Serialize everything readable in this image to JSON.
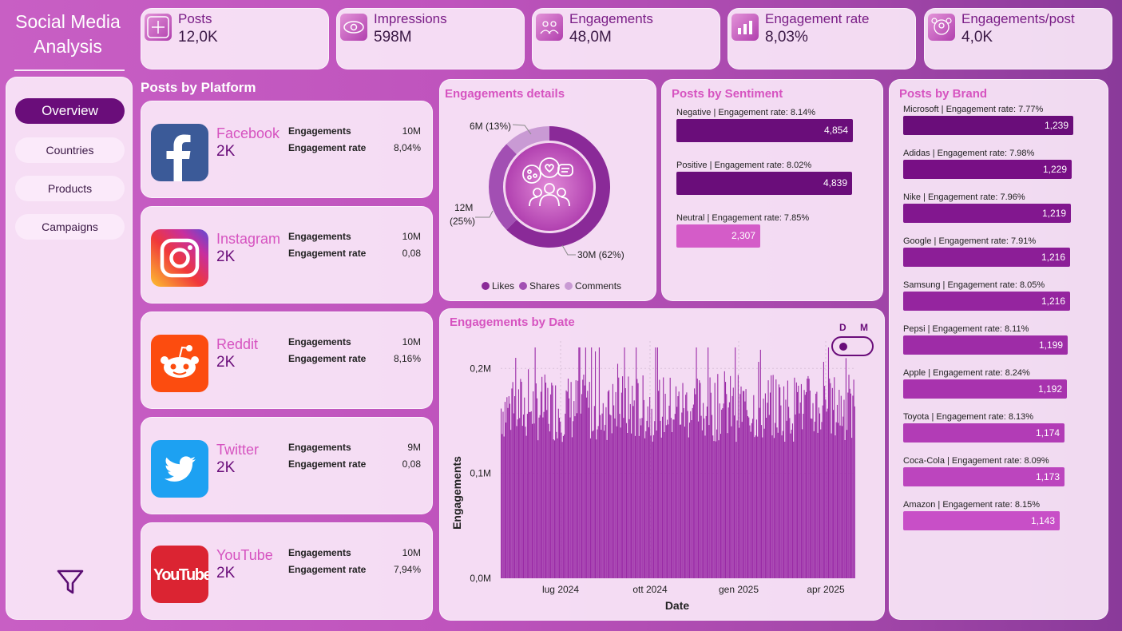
{
  "app": {
    "title_line1": "Social Media",
    "title_line2": "Analysis"
  },
  "nav": {
    "items": [
      {
        "label": "Overview",
        "active": true
      },
      {
        "label": "Countries",
        "active": false
      },
      {
        "label": "Products",
        "active": false
      },
      {
        "label": "Campaigns",
        "active": false
      }
    ]
  },
  "kpis": [
    {
      "label": "Posts",
      "value": "12,0K",
      "icon": "plus-icon"
    },
    {
      "label": "Impressions",
      "value": "598M",
      "icon": "eye-icon"
    },
    {
      "label": "Engagements",
      "value": "48,0M",
      "icon": "people-icon"
    },
    {
      "label": "Engagement rate",
      "value": "8,03%",
      "icon": "chart-icon"
    },
    {
      "label": "Engagements/post",
      "value": "4,0K",
      "icon": "users-icon"
    }
  ],
  "platforms": {
    "title": "Posts by Platform",
    "metric_labels": {
      "engagements": "Engagements",
      "rate": "Engagement rate"
    },
    "items": [
      {
        "name": "Facebook",
        "posts": "2K",
        "engagements": "10M",
        "rate": "8,04%",
        "icon": "facebook-icon"
      },
      {
        "name": "Instagram",
        "posts": "2K",
        "engagements": "10M",
        "rate": "0,08",
        "icon": "instagram-icon"
      },
      {
        "name": "Reddit",
        "posts": "2K",
        "engagements": "10M",
        "rate": "8,16%",
        "icon": "reddit-icon"
      },
      {
        "name": "Twitter",
        "posts": "2K",
        "engagements": "9M",
        "rate": "0,08",
        "icon": "twitter-icon"
      },
      {
        "name": "YouTube",
        "posts": "2K",
        "engagements": "10M",
        "rate": "7,94%",
        "icon": "youtube-icon"
      }
    ]
  },
  "engagement_details": {
    "title": "Engagements details",
    "slice_labels": [
      "30M (62%)",
      "12M",
      "(25%)",
      "6M (13%)"
    ],
    "legend": [
      "Likes",
      "Shares",
      "Comments"
    ]
  },
  "sentiment": {
    "title": "Posts by Sentiment",
    "items": [
      {
        "label": "Negative | Engagement rate: 8.14%",
        "value": 4854,
        "display": "4,854"
      },
      {
        "label": "Positive | Engagement rate: 8.02%",
        "value": 4839,
        "display": "4,839"
      },
      {
        "label": "Neutral | Engagement rate: 7.85%",
        "value": 2307,
        "display": "2,307"
      }
    ]
  },
  "brands": {
    "title": "Posts by Brand",
    "items": [
      {
        "label": "Microsoft | Engagement rate: 7.77%",
        "value": 1239,
        "display": "1,239"
      },
      {
        "label": "Adidas | Engagement rate: 7.98%",
        "value": 1229,
        "display": "1,229"
      },
      {
        "label": "Nike | Engagement rate: 7.96%",
        "value": 1219,
        "display": "1,219"
      },
      {
        "label": "Google | Engagement rate: 7.91%",
        "value": 1216,
        "display": "1,216"
      },
      {
        "label": "Samsung | Engagement rate: 8.05%",
        "value": 1216,
        "display": "1,216"
      },
      {
        "label": "Pepsi | Engagement rate: 8.11%",
        "value": 1199,
        "display": "1,199"
      },
      {
        "label": "Apple | Engagement rate: 8.24%",
        "value": 1192,
        "display": "1,192"
      },
      {
        "label": "Toyota | Engagement rate: 8.13%",
        "value": 1174,
        "display": "1,174"
      },
      {
        "label": "Coca-Cola | Engagement rate: 8.09%",
        "value": 1173,
        "display": "1,173"
      },
      {
        "label": "Amazon | Engagement rate: 8.15%",
        "value": 1143,
        "display": "1,143"
      }
    ]
  },
  "by_date": {
    "title": "Engagements by Date",
    "toggle": {
      "left": "D",
      "right": "M"
    },
    "xlabel": "Date",
    "ylabel": "Engagements",
    "ytick_labels": [
      "0,0M",
      "0,1M",
      "0,2M"
    ],
    "xtick_labels": [
      "lug 2024",
      "ott 2024",
      "gen 2025",
      "apr 2025"
    ]
  },
  "chart_data": [
    {
      "type": "pie",
      "title": "Engagements details",
      "categories": [
        "Likes",
        "Shares",
        "Comments"
      ],
      "values": [
        30,
        12,
        6
      ],
      "unit": "M",
      "percentages": [
        62,
        25,
        13
      ],
      "colors": [
        "#8a2a98",
        "#a24fb3",
        "#c99ad4"
      ],
      "legend_position": "bottom"
    },
    {
      "type": "bar",
      "orientation": "horizontal",
      "title": "Posts by Sentiment",
      "categories": [
        "Negative",
        "Positive",
        "Neutral"
      ],
      "values": [
        4854,
        4839,
        2307
      ],
      "colors": [
        "#6a0d7a",
        "#6a0d7a",
        "#d45cc8"
      ]
    },
    {
      "type": "bar",
      "orientation": "horizontal",
      "title": "Posts by Brand",
      "categories": [
        "Microsoft",
        "Adidas",
        "Nike",
        "Google",
        "Samsung",
        "Pepsi",
        "Apple",
        "Toyota",
        "Coca-Cola",
        "Amazon"
      ],
      "values": [
        1239,
        1229,
        1219,
        1216,
        1216,
        1199,
        1192,
        1174,
        1173,
        1143
      ]
    },
    {
      "type": "bar",
      "title": "Engagements by Date",
      "xlabel": "Date",
      "ylabel": "Engagements",
      "x_range": [
        "2024-05",
        "2025-05"
      ],
      "xticks": [
        "lug 2024",
        "ott 2024",
        "gen 2025",
        "apr 2025"
      ],
      "ylim": [
        0,
        0.22
      ],
      "y_unit": "M",
      "yticks": [
        0,
        0.1,
        0.2
      ],
      "color": "#9a2aa6",
      "grid": true,
      "approx_daily_range": [
        0.13,
        0.22
      ],
      "note_values_approx": "daily bars mostly between 0.13M and 0.22M"
    }
  ],
  "colors": {
    "accent": "#6a0d7a",
    "pink": "#d653c0",
    "background": "#c05abe"
  }
}
